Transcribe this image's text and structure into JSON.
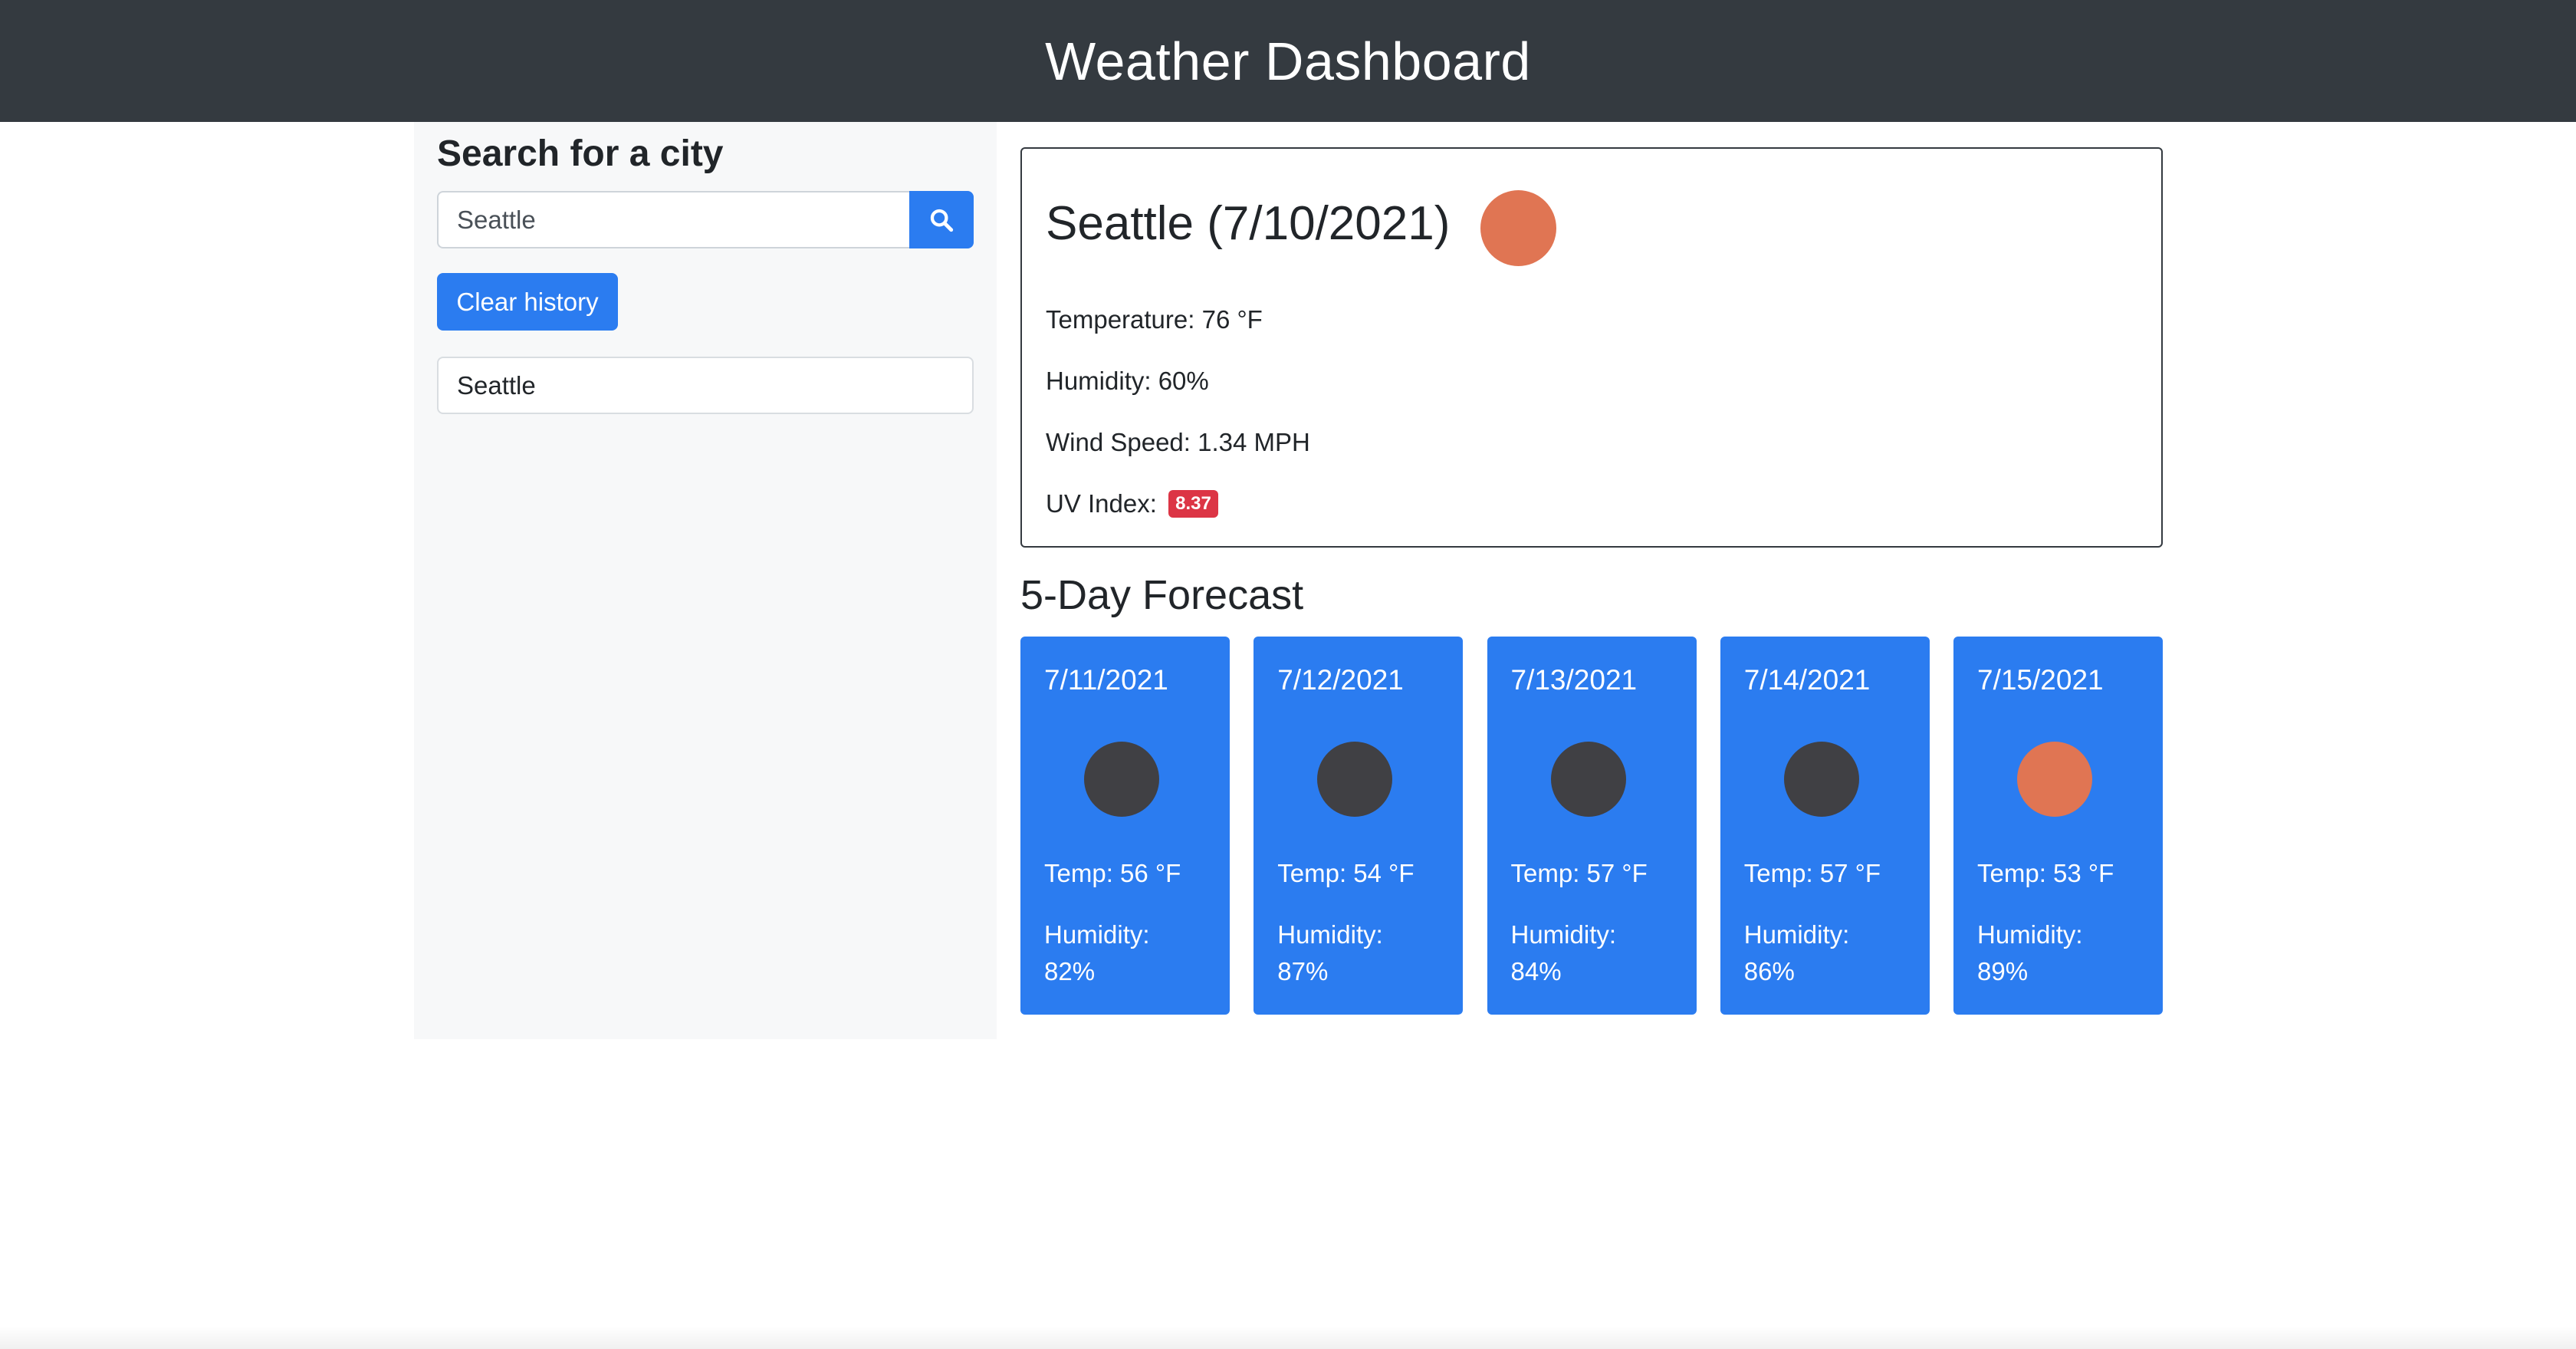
{
  "header": {
    "title": "Weather Dashboard"
  },
  "sidebar": {
    "title": "Search for a city",
    "search": {
      "value": "Seattle",
      "placeholder": ""
    },
    "search_button_icon": "search-icon",
    "clear_label": "Clear history",
    "history": [
      "Seattle"
    ]
  },
  "current": {
    "title": "Seattle (7/10/2021)",
    "icon_color": "#e07553",
    "temperature": "Temperature: 76 °F",
    "humidity": "Humidity: 60%",
    "wind": "Wind Speed: 1.34 MPH",
    "uv_label": "UV Index:",
    "uv_value": "8.37",
    "uv_color": "#dc3545"
  },
  "forecast": {
    "heading": "5-Day Forecast",
    "days": [
      {
        "date": "7/11/2021",
        "icon_color": "#404044",
        "temp": "Temp: 56 °F",
        "humidity_label": "Humidity:",
        "humidity": "82%"
      },
      {
        "date": "7/12/2021",
        "icon_color": "#404044",
        "temp": "Temp: 54 °F",
        "humidity_label": "Humidity:",
        "humidity": "87%"
      },
      {
        "date": "7/13/2021",
        "icon_color": "#404044",
        "temp": "Temp: 57 °F",
        "humidity_label": "Humidity:",
        "humidity": "84%"
      },
      {
        "date": "7/14/2021",
        "icon_color": "#404044",
        "temp": "Temp: 57 °F",
        "humidity_label": "Humidity:",
        "humidity": "86%"
      },
      {
        "date": "7/15/2021",
        "icon_color": "#e07553",
        "temp": "Temp: 53 °F",
        "humidity_label": "Humidity:",
        "humidity": "89%"
      }
    ]
  },
  "colors": {
    "header_bg": "#343a40",
    "primary": "#2b7cf0",
    "sidebar_bg": "#f7f8f9"
  }
}
